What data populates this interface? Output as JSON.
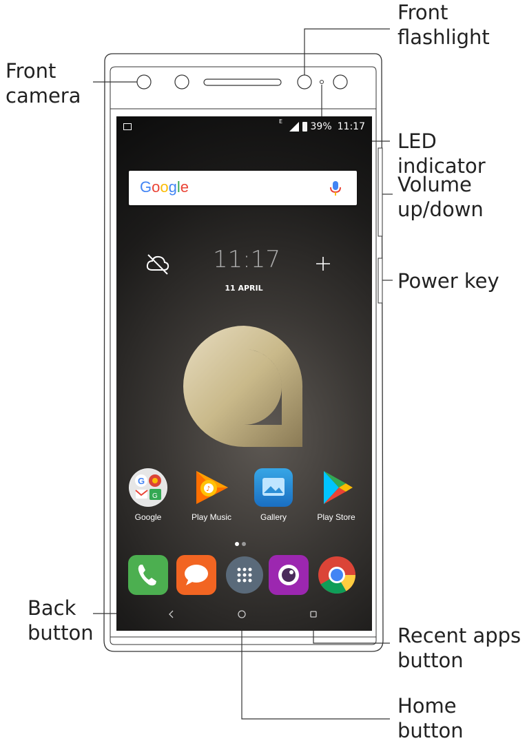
{
  "callouts": {
    "front_camera": "Front\ncamera",
    "front_flashlight": "Front\nflashlight",
    "led_indicator": "LED indicator",
    "volume": "Volume\nup/down",
    "power_key": "Power key",
    "back_button": "Back\nbutton",
    "recent_apps": "Recent apps\nbutton",
    "home_button": "Home\nbutton"
  },
  "status_bar": {
    "network": "E",
    "battery_percent": "39%",
    "time": "11:17"
  },
  "search": {
    "logo_text": "Google",
    "mic_icon": "mic-icon"
  },
  "clock_widget": {
    "time": "11:17",
    "date": "11 APRIL"
  },
  "apps": [
    {
      "label": "Google",
      "icon": "google-folder-icon"
    },
    {
      "label": "Play Music",
      "icon": "play-music-icon"
    },
    {
      "label": "Gallery",
      "icon": "gallery-icon"
    },
    {
      "label": "Play Store",
      "icon": "play-store-icon"
    }
  ],
  "dock": [
    {
      "icon": "phone-icon",
      "color": "#4CAF50"
    },
    {
      "icon": "messages-icon",
      "color": "#F26522"
    },
    {
      "icon": "app-drawer-icon",
      "color": "#5a6a7a"
    },
    {
      "icon": "camera-icon",
      "color": "#9C27B0"
    },
    {
      "icon": "chrome-icon",
      "color": "#DB4437"
    }
  ],
  "colors": {
    "google_blue": "#4285F4",
    "google_red": "#EA4335",
    "google_yellow": "#FBBC05",
    "google_green": "#34A853",
    "logo_gold": "#c9b98a"
  }
}
